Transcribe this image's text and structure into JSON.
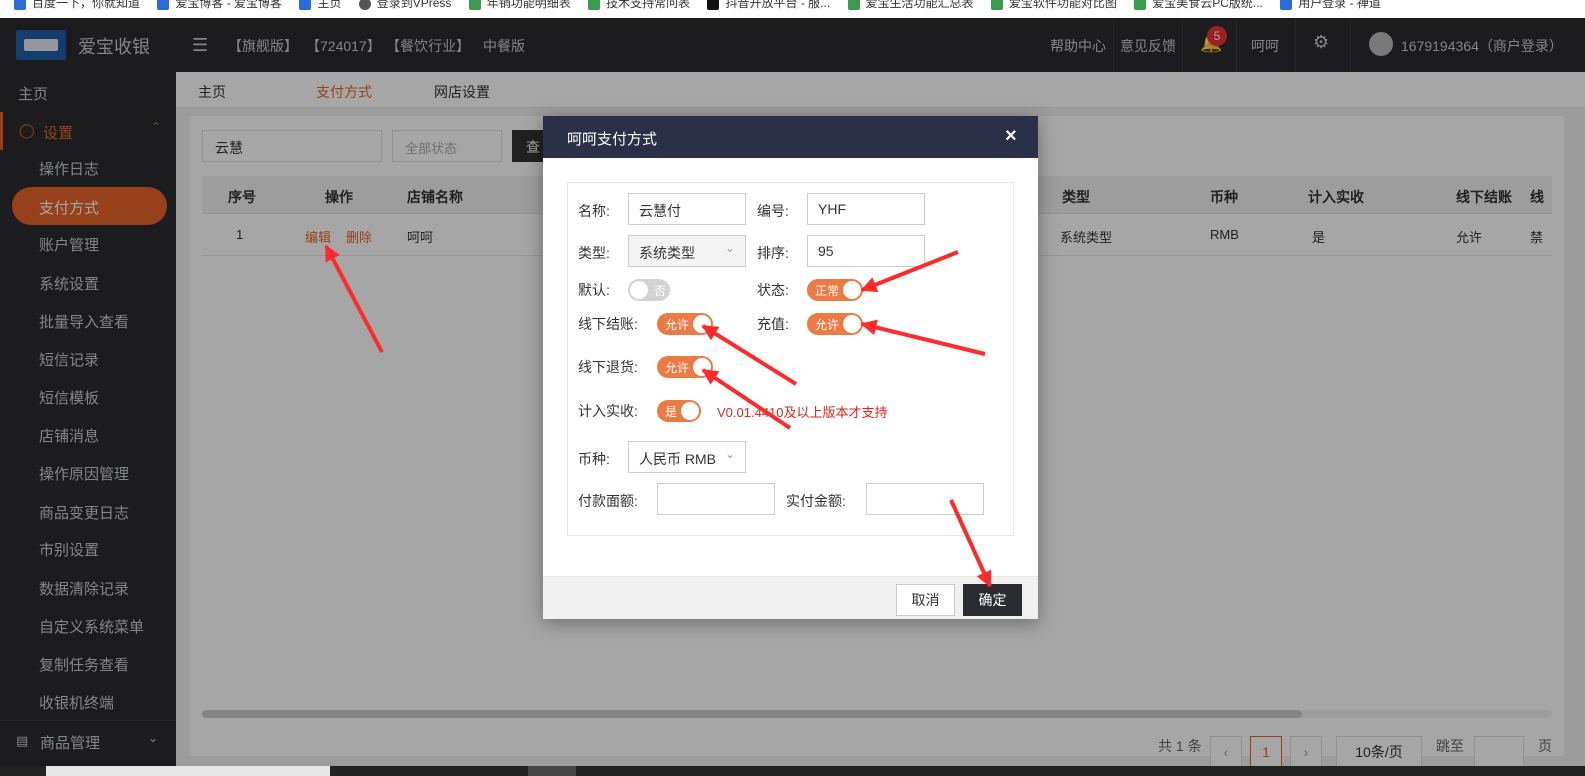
{
  "bookmarks": [
    "百度一下，你就知道",
    "爱宝博客 - 爱宝博客",
    "主页",
    "登录到VPress",
    "年销功能明细表",
    "技术支持常问表",
    "抖音开放平台 - 服...",
    "爱宝生活功能汇总表",
    "爱宝软件功能对比图",
    "爱宝美食云PC版统...",
    "用户登录 - 禅道"
  ],
  "header": {
    "brand": "爱宝收银",
    "menu_icon": "☰",
    "tags": [
      "【旗舰版】",
      "【724017】",
      "【餐饮行业】",
      "中餐版"
    ],
    "help": "帮助中心",
    "feedback": "意见反馈",
    "notif_count": "5",
    "user_name": "呵呵",
    "account": "1679194364（商户登录）"
  },
  "sidebar": {
    "home": "主页",
    "settings": "设置",
    "items": [
      "操作日志",
      "支付方式",
      "账户管理",
      "系统设置",
      "批量导入查看",
      "短信记录",
      "短信模板",
      "店铺消息",
      "操作原因管理",
      "商品变更日志",
      "市别设置",
      "数据清除记录",
      "自定义系统菜单",
      "复制任务查看",
      "收银机终端"
    ],
    "goods": "商品管理"
  },
  "tabs": [
    "主页",
    "支付方式",
    "网店设置"
  ],
  "toolbar": {
    "search_value": "云慧",
    "status_placeholder": "全部状态",
    "query_label": "查"
  },
  "table": {
    "headers": [
      "序号",
      "操作",
      "店铺名称",
      "类型",
      "币种",
      "计入实收",
      "线下结账",
      "线"
    ],
    "row": {
      "index": "1",
      "edit": "编辑",
      "delete": "删除",
      "store": "呵呵",
      "type": "系统类型",
      "currency": "RMB",
      "counted": "是",
      "offline_checkout": "允许",
      "extra": "禁"
    }
  },
  "pagination": {
    "total": "共 1 条",
    "current": "1",
    "page_size": "10条/页",
    "goto": "跳至",
    "page_unit": "页"
  },
  "modal": {
    "title": "呵呵支付方式",
    "close": "×",
    "name_label": "名称:",
    "name_value": "云慧付",
    "code_label": "编号:",
    "code_value": "YHF",
    "type_label": "类型:",
    "type_value": "系统类型",
    "sort_label": "排序:",
    "sort_value": "95",
    "default_label": "默认:",
    "default_state": "否",
    "status_label": "状态:",
    "status_state": "正常",
    "offline_checkout_label": "线下结账:",
    "offline_checkout_state": "允许",
    "recharge_label": "充值:",
    "recharge_state": "允许",
    "offline_return_label": "线下退货:",
    "offline_return_state": "允许",
    "counted_label": "计入实收:",
    "counted_state": "是",
    "version_note": "V0.01.4410及以上版本才支持",
    "currency_label": "币种:",
    "currency_value": "人民币 RMB",
    "face_amount_label": "付款面额:",
    "face_amount_value": "",
    "actual_amount_label": "实付金额:",
    "actual_amount_value": "",
    "cancel": "取消",
    "confirm": "确定"
  },
  "colors": {
    "accent": "#e8642b",
    "header_bg": "#2b2c30",
    "modal_header": "#2c2f48",
    "switch_on": "#ec7a44",
    "annotation_red": "#e0251b"
  }
}
